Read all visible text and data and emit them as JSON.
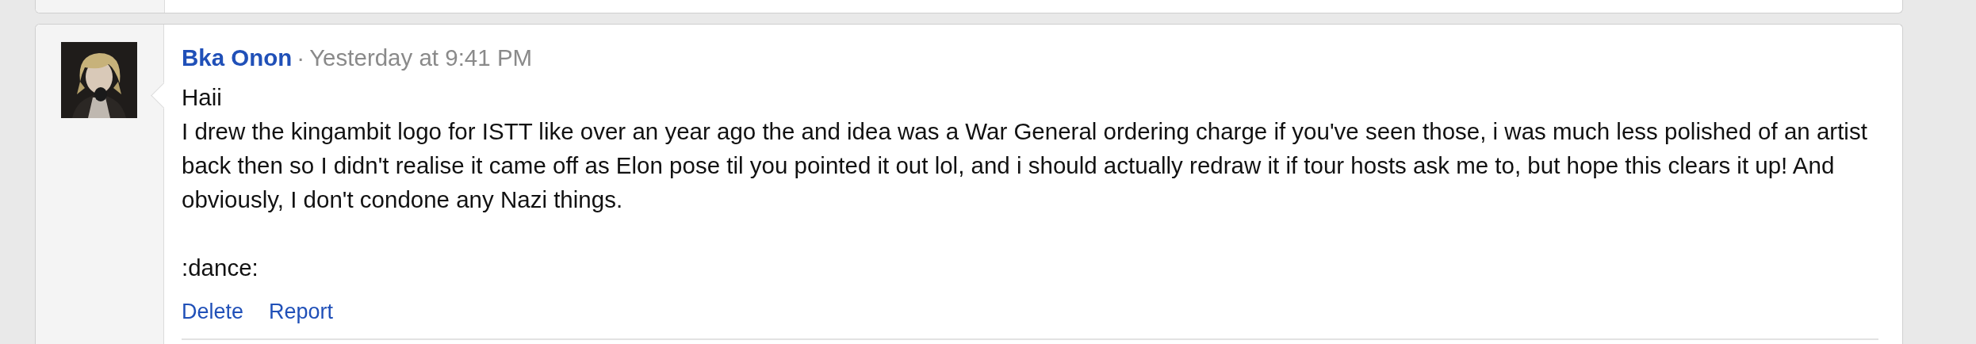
{
  "previous_comment": {
    "kind": "card"
  },
  "comment": {
    "author": "Bka Onon",
    "separator": "·",
    "timestamp": "Yesterday at 9:41 PM",
    "body": [
      "Haii\nI drew the kingambit logo for ISTT like over an year ago the and idea was a War General ordering charge if you've seen those, i was much less polished of an artist back then so I didn't realise it came off as Elon pose til you pointed it out lol, and i should actually redraw it if tour hosts ask me to, but hope this clears it up! And obviously, I don't condone any Nazi things.",
      ":dance:"
    ],
    "actions": [
      "Delete",
      "Report"
    ]
  }
}
